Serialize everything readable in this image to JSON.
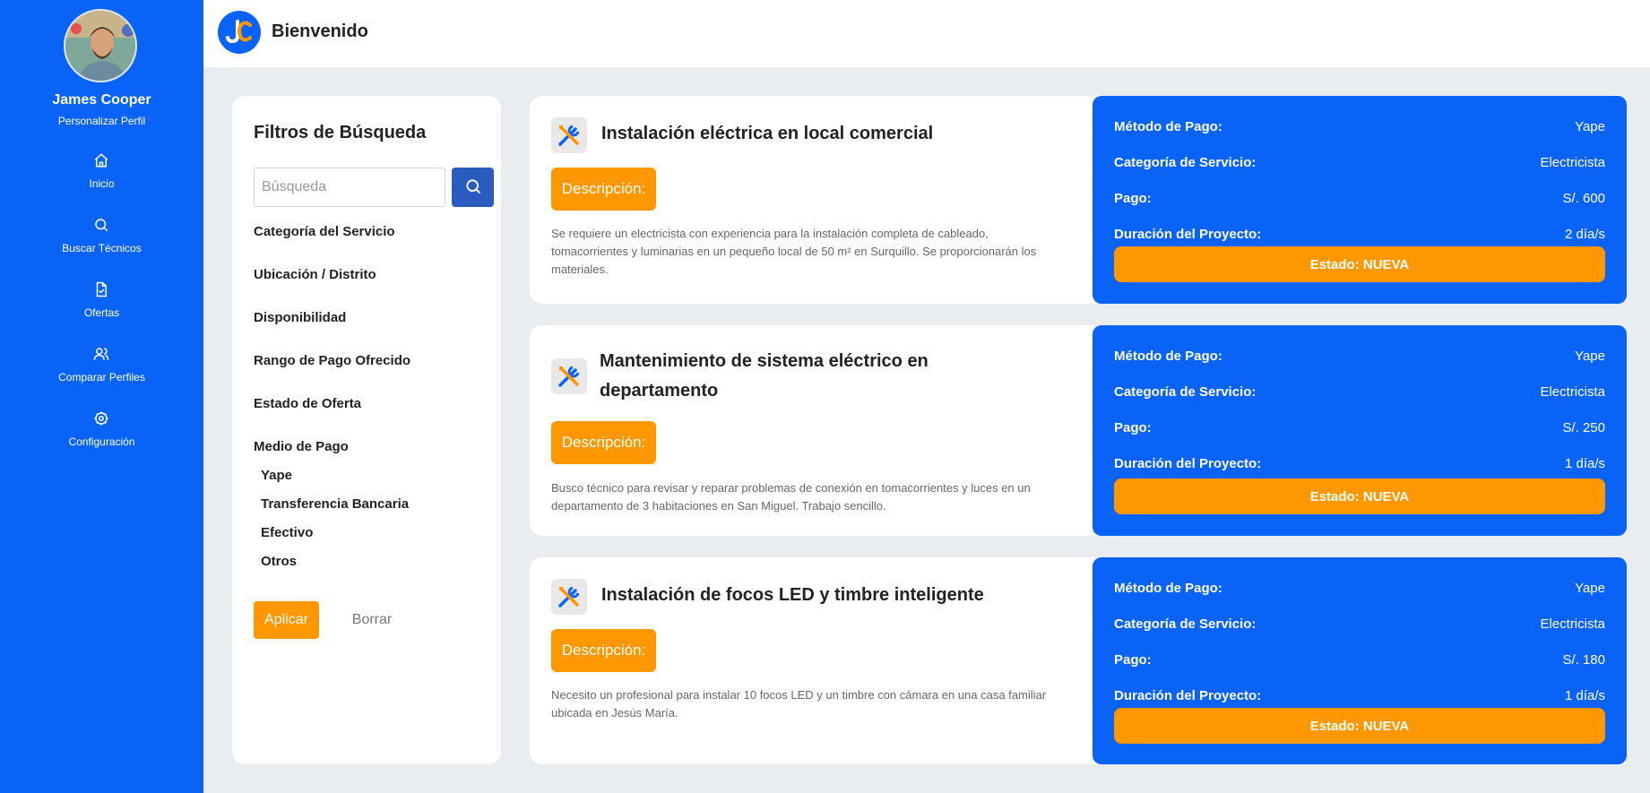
{
  "colors": {
    "primary": "#0a63f7",
    "accent": "#ff9800",
    "search_button": "#2a5bbf"
  },
  "sidebar": {
    "user_name": "James Cooper",
    "profile_link": "Personalizar Perfil",
    "items": [
      {
        "label": "Inicio",
        "icon": "home-icon"
      },
      {
        "label": "Buscar Técnicos",
        "icon": "search-icon"
      },
      {
        "label": "Ofertas",
        "icon": "document-check-icon"
      },
      {
        "label": "Comparar Perfiles",
        "icon": "users-icon"
      },
      {
        "label": "Configuración",
        "icon": "gear-icon"
      }
    ]
  },
  "header": {
    "title": "Bienvenido"
  },
  "filters": {
    "title": "Filtros de Búsqueda",
    "search_placeholder": "Búsqueda",
    "categories": [
      "Categoría del Servicio",
      "Ubicación / Distrito",
      "Disponibilidad",
      "Rango de Pago Ofrecido",
      "Estado de Oferta",
      "Medio de Pago"
    ],
    "payment_options": [
      "Yape",
      "Transferencia Bancaria",
      "Efectivo",
      "Otros"
    ],
    "apply_label": "Aplicar",
    "clear_label": "Borrar"
  },
  "offers": [
    {
      "title": "Instalación eléctrica en local comercial",
      "description_label": "Descripción:",
      "description": "Se requiere un electricista con experiencia para la instalación completa de cableado, tomacorrientes y luminarias en un pequeño local de 50 m² en Surquillo. Se proporcionarán los materiales.",
      "info": {
        "payment_method_label": "Método de Pago:",
        "payment_method": "Yape",
        "category_label": "Categoría de Servicio:",
        "category": "Electricista",
        "pay_label": "Pago:",
        "pay": "S/. 600",
        "duration_label": "Duración del Proyecto:",
        "duration": "2 día/s"
      },
      "status": "Estado: NUEVA"
    },
    {
      "title": "Mantenimiento de sistema eléctrico en departamento",
      "description_label": "Descripción:",
      "description": "Busco técnico para revisar y reparar problemas de conexión en tomacorrientes y luces en un departamento de 3 habitaciones en San Miguel. Trabajo sencillo.",
      "info": {
        "payment_method_label": "Método de Pago:",
        "payment_method": "Yape",
        "category_label": "Categoría de Servicio:",
        "category": "Electricista",
        "pay_label": "Pago:",
        "pay": "S/. 250",
        "duration_label": "Duración del Proyecto:",
        "duration": "1 día/s"
      },
      "status": "Estado: NUEVA"
    },
    {
      "title": "Instalación de focos LED y timbre inteligente",
      "description_label": "Descripción:",
      "description": "Necesito un profesional para instalar 10 focos LED y un timbre con cámara en una casa familiar ubicada en Jesús María.",
      "info": {
        "payment_method_label": "Método de Pago:",
        "payment_method": "Yape",
        "category_label": "Categoría de Servicio:",
        "category": "Electricista",
        "pay_label": "Pago:",
        "pay": "S/. 180",
        "duration_label": "Duración del Proyecto:",
        "duration": "1 día/s"
      },
      "status": "Estado: NUEVA"
    }
  ]
}
